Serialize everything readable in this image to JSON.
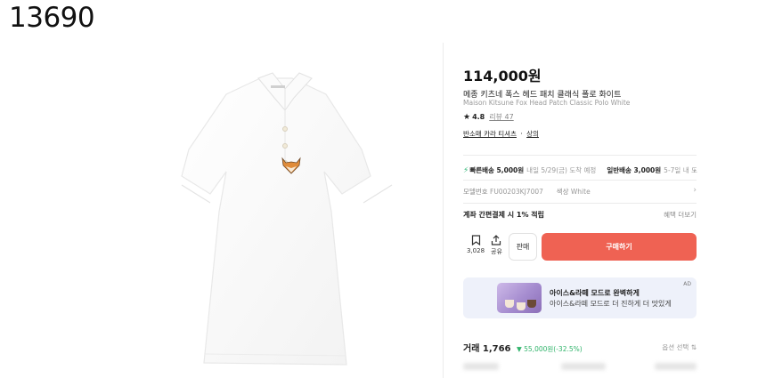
{
  "page_id_label": "13690",
  "product": {
    "price": "114,000원",
    "name_ko": "메종 키츠네 폭스 헤드 패치 클래식 폴로 화이트",
    "name_en": "Maison Kitsune Fox Head Patch Classic Polo White",
    "rating": "4.8",
    "reviews": "리뷰 47",
    "category_main": "반소매 카라 티셔츠",
    "category_sep": "·",
    "category_sub": "상의"
  },
  "shipping": {
    "fast_label": "빠른배송 5,000원",
    "fast_eta": "내일 5/29(금) 도착 예정",
    "normal_label": "일반배송 3,000원",
    "normal_eta": "5-7일 내 도"
  },
  "details": {
    "model_label": "모델번호",
    "model_value": "FU00203KJ7007",
    "color_label": "색상",
    "color_value": "White"
  },
  "benefit": {
    "text": "계좌 간편결제 시 1% 적립",
    "more": "혜택 더보기"
  },
  "actions": {
    "bookmark_count": "3,028",
    "share_label": "공유",
    "sell_label": "판매",
    "buy_label": "구매하기"
  },
  "ad": {
    "title": "아이스&라떼 모드로 완벽하게",
    "subtitle": "아이스&라떼 모드로 더 진하게 더 맛있게",
    "badge": "AD"
  },
  "trade": {
    "label": "거래 1,766",
    "change": "▼ 55,000원(-32.5%)",
    "option": "옵션 선택 ⇅"
  },
  "colors": {
    "buy_button": "#ef6253",
    "fast_shipping": "#2bb673",
    "price_down": "#31b46b",
    "ad_background": "#eef1fa"
  },
  "icons": [
    "bolt-icon",
    "star-icon",
    "bookmark-icon",
    "share-icon",
    "chevron-right-icon",
    "sort-icon"
  ]
}
